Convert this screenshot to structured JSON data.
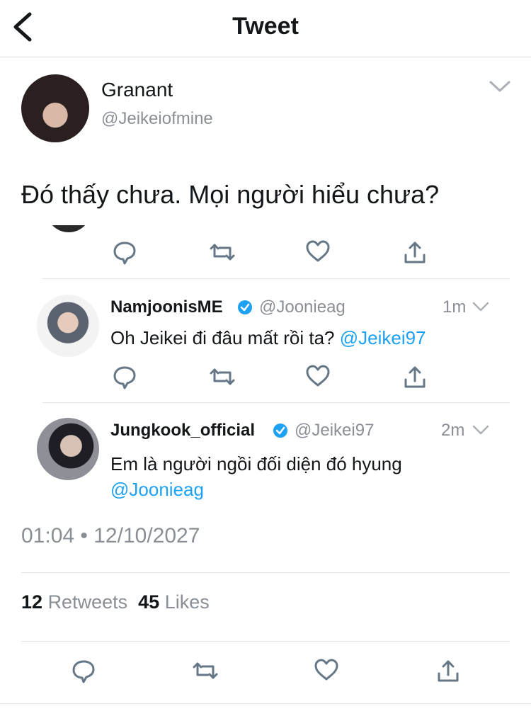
{
  "header": {
    "title": "Tweet"
  },
  "tweet": {
    "name": "Granant",
    "handle": "@Jeikeiofmine",
    "text": "Đó thấy chưa. Mọi người hiểu chưa?",
    "timestamp": "01:04 • 12/10/2027",
    "retweet_count": "12",
    "retweet_label": "Retweets",
    "like_count": "45",
    "like_label": "Likes"
  },
  "replies": [
    {
      "name": "NamjoonisME",
      "handle": "@Joonieag",
      "time": "1m",
      "text": "Oh Jeikei đi đâu mất rồi ta?",
      "mention": "@Jeikei97"
    },
    {
      "name": "Jungkook_official",
      "handle": "@Jeikei97",
      "time": "2m",
      "text": "Em là người ngồi đối diện đó hyung",
      "mention": "@Joonieag"
    }
  ],
  "icons": [
    "back-chevron-icon",
    "chevron-down-icon",
    "reply-icon",
    "retweet-icon",
    "like-icon",
    "share-icon",
    "verified-badge-icon"
  ],
  "colors": {
    "link": "#1da1f2",
    "secondary_text": "#8a8f95",
    "divider": "#e1e3e6",
    "icon": "#657786"
  }
}
